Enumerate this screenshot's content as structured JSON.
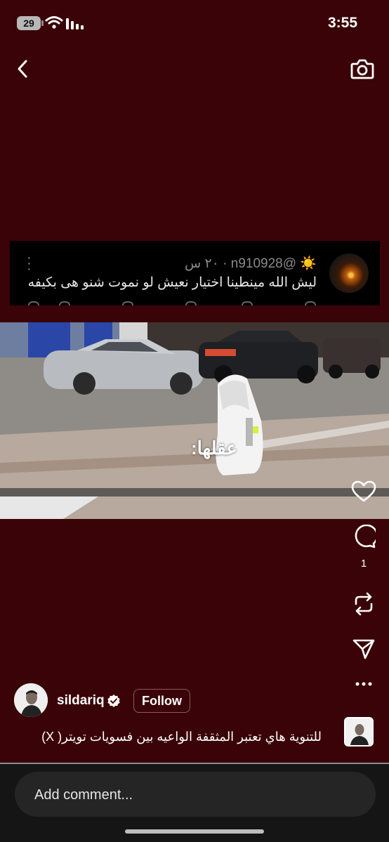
{
  "status_bar": {
    "battery": "29",
    "time": "3:55"
  },
  "tweet": {
    "sun_emoji": "☀️",
    "meta": "@n910928 · ٢٠ س",
    "text": "ليش الله مينطينا اختيار نعيش لو نموت شنو هى بكيفه"
  },
  "video": {
    "overlay_text": "عقلها:"
  },
  "actions": {
    "like": "heart-icon",
    "comment": "comment-icon",
    "comment_count": "1",
    "repost": "repost-icon",
    "share": "send-icon",
    "more": "more-icon"
  },
  "post": {
    "username": "sildariq",
    "follow_label": "Follow",
    "caption": "للتنوية هاي تعتبر المثقفة الواعيه بين فسويات تويتر( X)"
  },
  "comment_box": {
    "placeholder": "Add comment..."
  },
  "colors": {
    "background": "#3a0307",
    "bottom_bar": "#151515",
    "input": "#252525"
  }
}
